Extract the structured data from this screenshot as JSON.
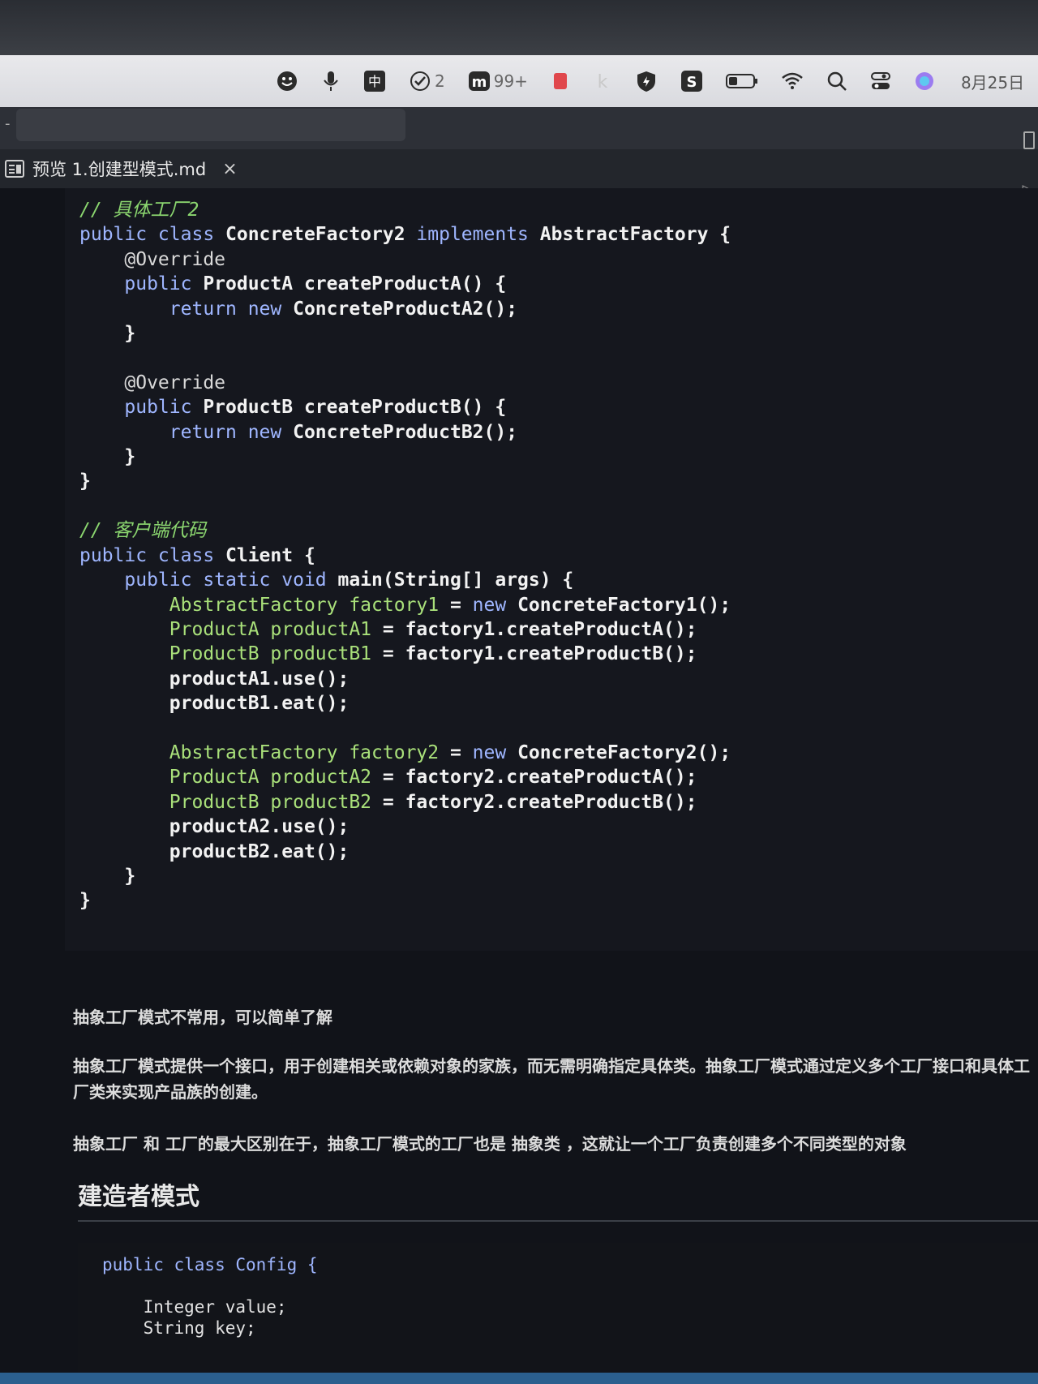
{
  "menubar": {
    "task_count": "2",
    "notif_count": "99+",
    "date": "8月25日"
  },
  "tab": {
    "title": "预览 1.创建型模式.md",
    "close_glyph": "×"
  },
  "code1": {
    "comment1": "// 具体工厂2",
    "comment2": "// 客户端代码"
  },
  "paragraphs": {
    "p1": "抽象工厂模式不常用，可以简单了解",
    "p2": "抽象工厂模式提供一个接口，用于创建相关或依赖对象的家族，而无需明确指定具体类。抽象工厂模式通过定义多个工厂接口和具体工厂类来实现产品族的创建。",
    "p3": "抽象工厂 和 工厂的最大区别在于，抽象工厂模式的工厂也是 抽象类 ，这就让一个工厂负责创建多个不同类型的对象"
  },
  "heading": "建造者模式",
  "code2_lines": [
    "public class Config {",
    "",
    "    Integer value;",
    "    String key;"
  ]
}
